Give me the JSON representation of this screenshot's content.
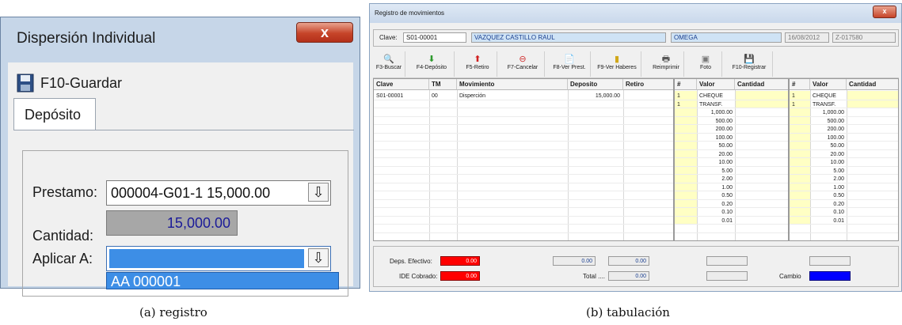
{
  "panel_a": {
    "window_title": "Dispersión Individual",
    "close_glyph": "x",
    "save_label": "F10-Guardar",
    "tab_label": "Depósito",
    "prestamo_label": "Prestamo:",
    "prestamo_value": "000004-G01-1 15,000.00",
    "cantidad_label": "Cantidad:",
    "cantidad_value": "15,000.00",
    "aplicar_label": "Aplicar A:",
    "aplicar_value": "",
    "dropdown_option": "AA 000001",
    "dropdown_glyph": "⇩"
  },
  "panel_b": {
    "window_title": "Registro de movimientos",
    "clave_label": "Clave:",
    "clave_value": "S01-00001",
    "nombre_value": "VAZQUEZ CASTILLO RAUL",
    "empresa_value": "OMEGA",
    "fecha_value": "16/08/2012",
    "folio_value": "Z-017580",
    "toolbar": [
      {
        "label": "F3-Buscar",
        "icon": "magnifier-icon",
        "glyph": "🔍"
      },
      {
        "label": "F4-Depósito",
        "icon": "arrow-down-green-icon",
        "glyph": "⬇"
      },
      {
        "label": "F5-Retiro",
        "icon": "arrow-up-red-icon",
        "glyph": "⬆"
      },
      {
        "label": "F7-Cancelar",
        "icon": "cancel-icon",
        "glyph": "⊖"
      },
      {
        "label": "F8-Ver Prest.",
        "icon": "document-icon",
        "glyph": "📄"
      },
      {
        "label": "F9-Ver Haberes",
        "icon": "chart-icon",
        "glyph": "▮"
      },
      {
        "label": "Reimprimir",
        "icon": "printer-icon",
        "glyph": "🖶"
      },
      {
        "label": "Foto",
        "icon": "camera-icon",
        "glyph": "▣"
      },
      {
        "label": "F10-Registrar",
        "icon": "floppy-icon",
        "glyph": "💾"
      }
    ],
    "grid_headers": [
      "Clave",
      "TM",
      "Movimiento",
      "Deposito",
      "Retiro"
    ],
    "grid_rows": [
      {
        "clave": "S01-00001",
        "tm": "00",
        "movimiento": "Disperción",
        "deposito": "15,000.00",
        "retiro": ""
      }
    ],
    "denom_headers": [
      "#",
      "Valor",
      "Cantidad"
    ],
    "denom_left_numbers": [
      "1",
      "1"
    ],
    "denom_right_numbers": [
      "1",
      "1"
    ],
    "denom_values": [
      "CHEQUE",
      "TRANSF.",
      "1,000.00",
      "500.00",
      "200.00",
      "100.00",
      "50.00",
      "20.00",
      "10.00",
      "5.00",
      "2.00",
      "1.00",
      "0.50",
      "0.20",
      "0.10",
      "0.01"
    ],
    "footer": {
      "deps_efectivo_label": "Deps. Efectivo:",
      "deps_efectivo_value": "0.00",
      "ide_cobrado_label": "IDE Cobrado:",
      "ide_cobrado_value": "0.00",
      "mid_value_1": "0.00",
      "mid_value_2": "0.00",
      "total_label": "Total ....",
      "total_value": "0.00",
      "cambio_label": "Cambio"
    }
  },
  "captions": {
    "a": "(a)  registro",
    "b": "(b)  tabulación"
  },
  "colors": {
    "red_field": "#ff0000",
    "blue_field": "#0000ff",
    "yellow_cell": "#ffffc4",
    "selection": "#3d8ee6"
  }
}
